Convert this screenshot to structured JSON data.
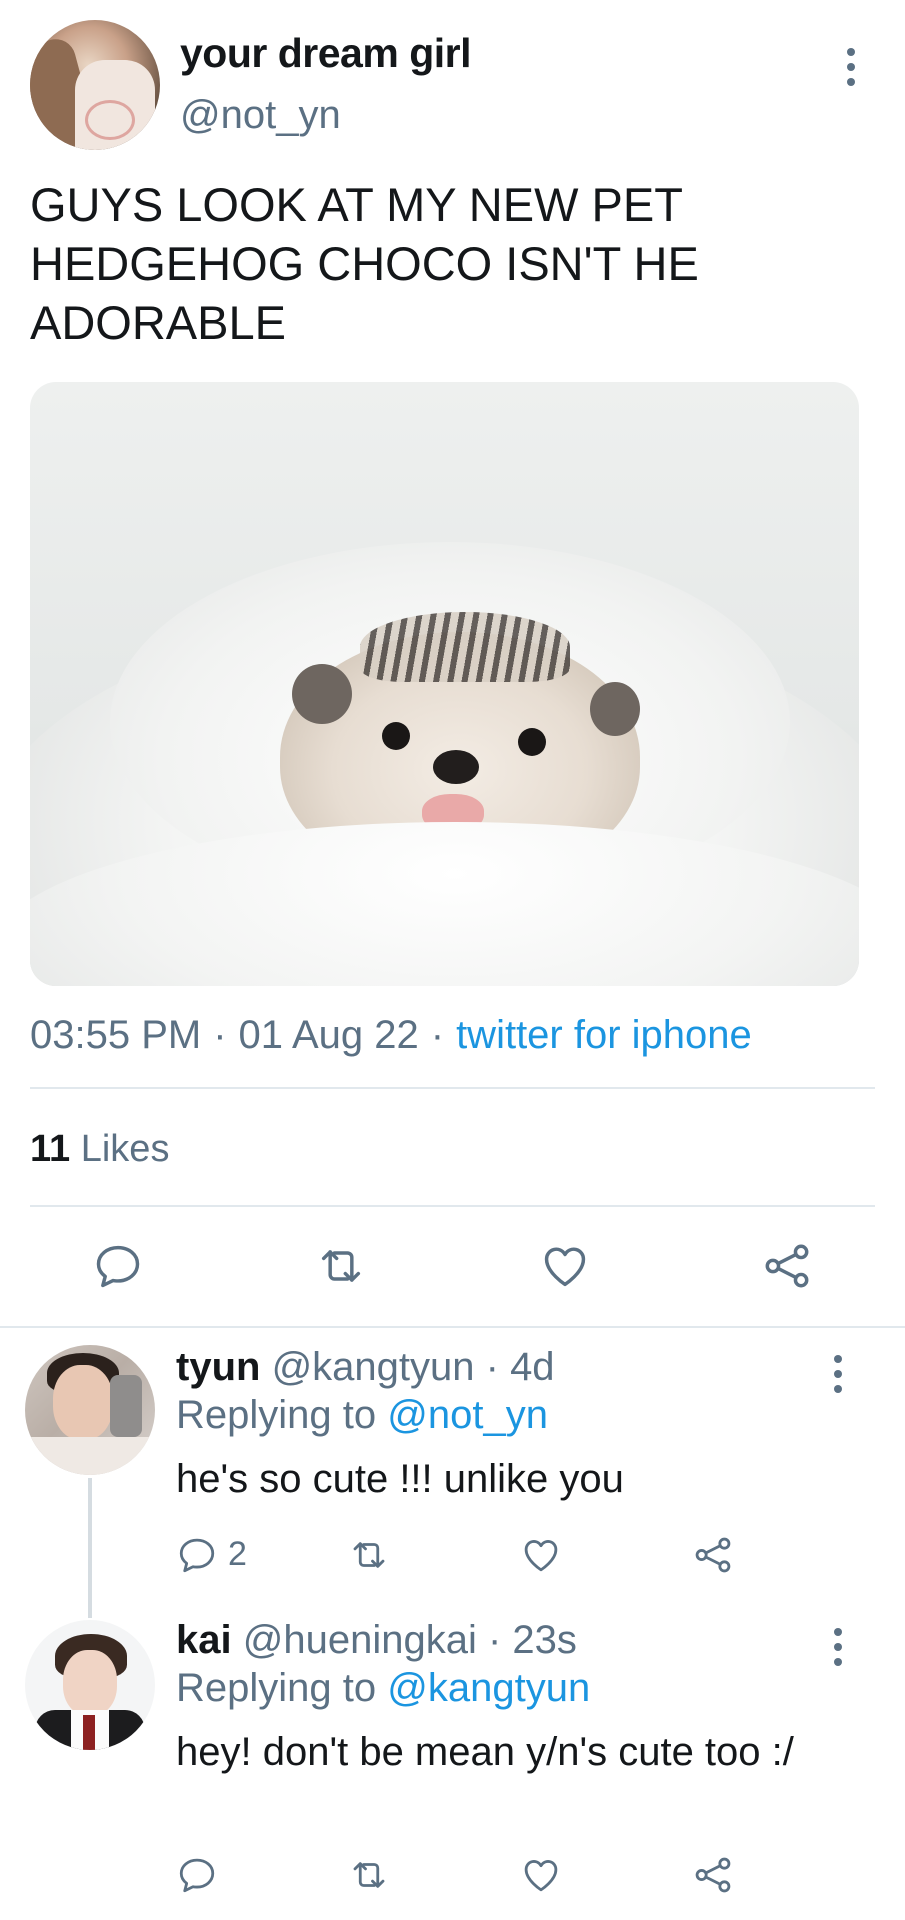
{
  "tweet": {
    "display_name": "your dream girl",
    "handle": "@not_yn",
    "text": "GUYS LOOK AT MY NEW PET HEDGEHOG CHOCO ISN'T HE ADORABLE",
    "time": "03:55 PM",
    "date": "01 Aug 22",
    "source": "twitter for iphone",
    "likes_count": "11",
    "likes_label": "Likes",
    "actions": [
      "reply-icon",
      "retweet-icon",
      "like-icon",
      "share-icon"
    ]
  },
  "replies": [
    {
      "name": "tyun",
      "handle": "@kangtyun",
      "age": "4d",
      "replying_prefix": "Replying to",
      "replying_to": "@not_yn",
      "text": "he's so cute !!! unlike you",
      "reply_count": "2"
    },
    {
      "name": "kai",
      "handle": "@hueningkai",
      "age": "23s",
      "replying_prefix": "Replying to",
      "replying_to": "@kangtyun",
      "text": "hey! don't be mean y/n's cute too :/"
    }
  ],
  "colors": {
    "text": "#14171a",
    "secondary": "#5b7083",
    "link": "#1b95e0",
    "divider": "#e1e8ed"
  }
}
